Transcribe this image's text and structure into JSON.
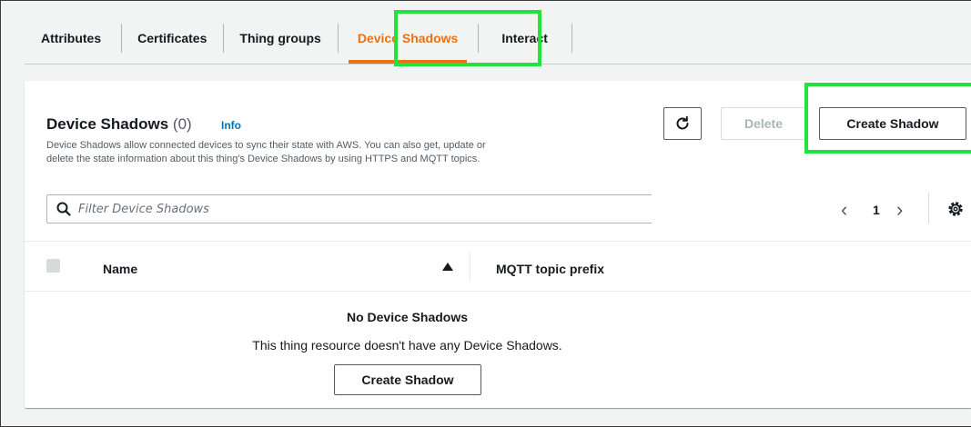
{
  "tabs": [
    {
      "label": "Attributes",
      "active": false
    },
    {
      "label": "Certificates",
      "active": false
    },
    {
      "label": "Thing groups",
      "active": false
    },
    {
      "label": "Device Shadows",
      "active": true
    },
    {
      "label": "Interact",
      "active": false
    }
  ],
  "panel": {
    "title": "Device Shadows",
    "count": "(0)",
    "info_label": "Info",
    "description_line1": "Device Shadows allow connected devices to sync their state with AWS. You can also get, update or",
    "description_line2": "delete the state information about this thing's Device Shadows by using HTTPS and MQTT topics.",
    "delete_label": "Delete",
    "create_label": "Create Shadow"
  },
  "filter": {
    "placeholder": "Filter Device Shadows",
    "value": ""
  },
  "pagination": {
    "current_page": "1"
  },
  "table": {
    "columns": [
      "Name",
      "MQTT topic prefix"
    ],
    "rows": []
  },
  "empty_state": {
    "title": "No Device Shadows",
    "description": "This thing resource doesn't have any Device Shadows.",
    "button_label": "Create Shadow"
  },
  "icons": {
    "refresh": "refresh-icon",
    "search": "search-icon",
    "prev": "chevron-left-icon",
    "next": "chevron-right-icon",
    "settings": "gear-icon",
    "sort": "sort-ascending-icon"
  },
  "colors": {
    "active_tab": "#ec7211",
    "link": "#0073bb",
    "highlight": "#22e33b"
  }
}
